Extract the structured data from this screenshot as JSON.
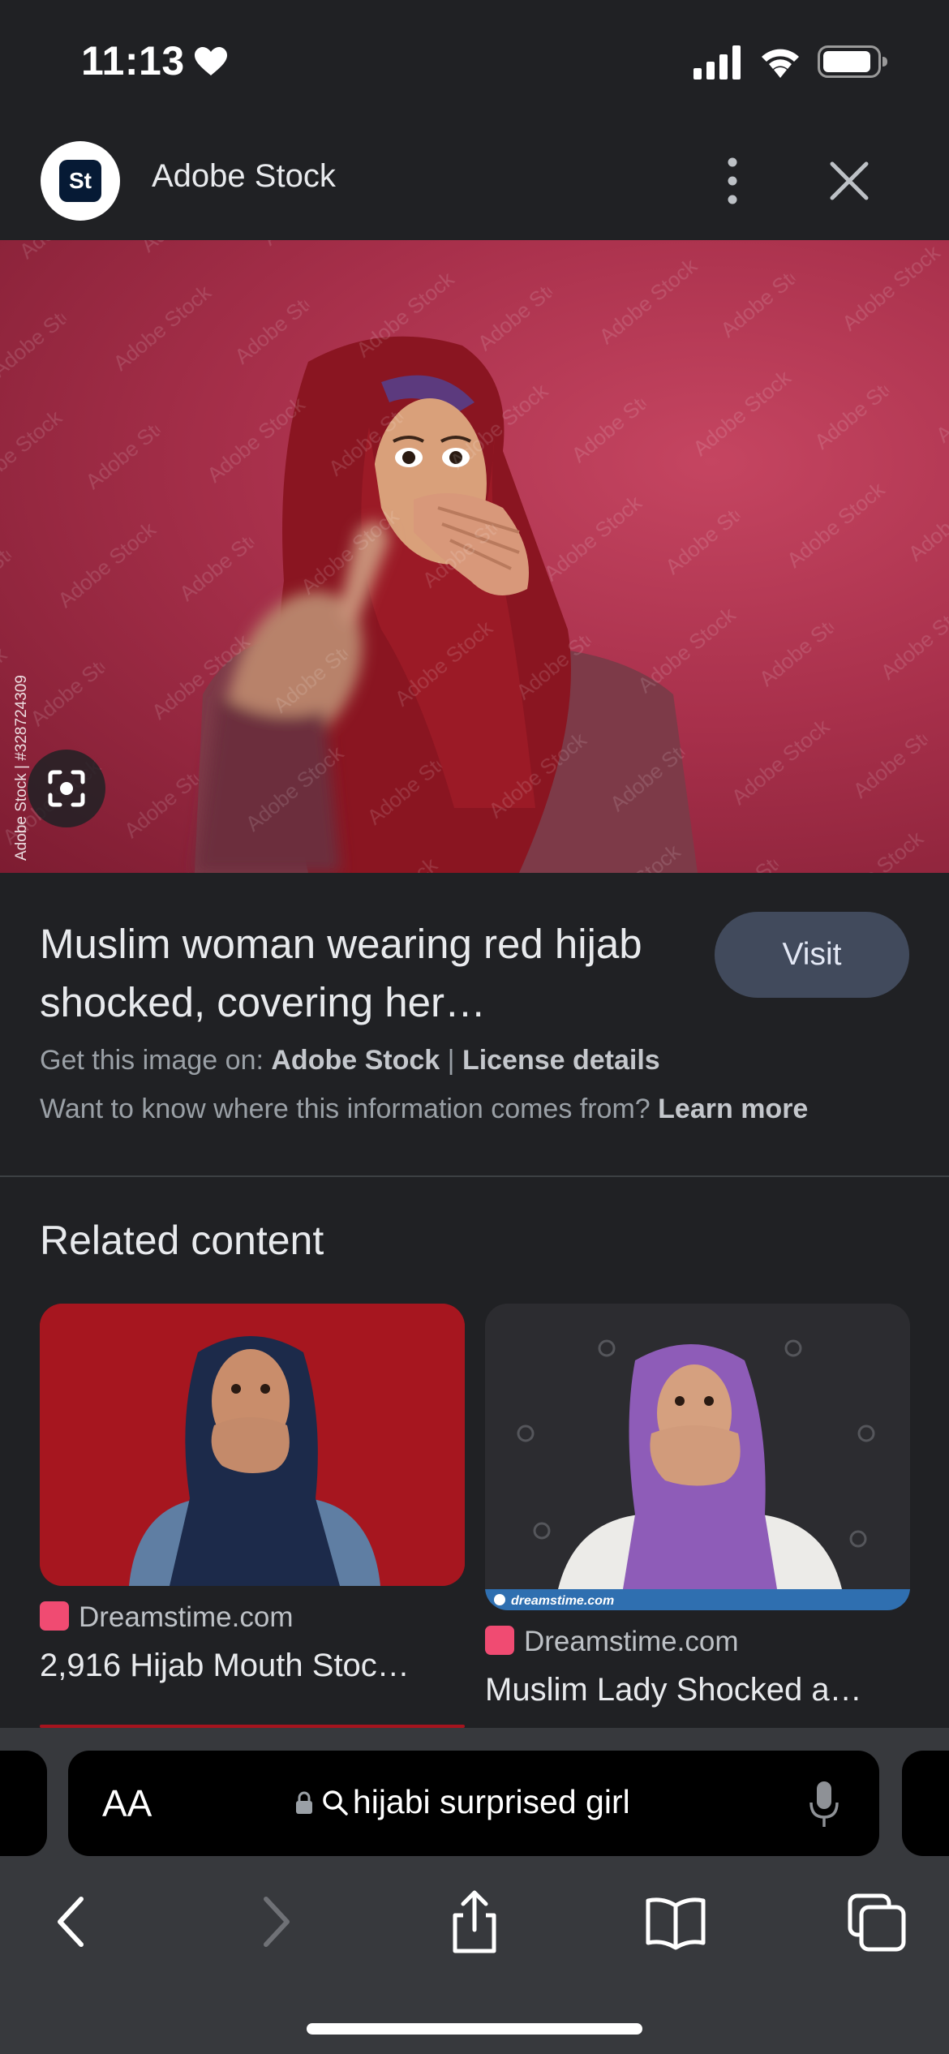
{
  "status_bar": {
    "time": "11:13",
    "icons": [
      "heart-icon",
      "signal-icon",
      "wifi-icon",
      "battery-icon"
    ]
  },
  "header": {
    "logo_text": "St",
    "title": "Adobe Stock",
    "icons": [
      "more-vert-icon",
      "close-icon"
    ]
  },
  "hero": {
    "credit": "Adobe Stock | #328724309",
    "watermark": "Adobe Stock",
    "lens_icon": "lens-search-icon"
  },
  "result": {
    "title": "Muslim woman wearing red hijab shocked, covering her…",
    "visit_label": "Visit",
    "source_prefix": "Get this image on:",
    "source_name": "Adobe Stock",
    "separator": "|",
    "license_label": "License details",
    "info_text": "Want to know where this information comes from?",
    "learn_more_label": "Learn more"
  },
  "related": {
    "heading": "Related content",
    "items": [
      {
        "source": "Dreamstime.com",
        "title": "2,916 Hijab Mouth Stoc…"
      },
      {
        "source": "Dreamstime.com",
        "title": "Muslim Lady Shocked a…",
        "image_caption": "dreamstime.com"
      }
    ]
  },
  "browser_bar": {
    "text_size_label": "AA",
    "url_text": "hijabi surprised girl",
    "icons": [
      "lock-icon",
      "search-icon",
      "mic-icon",
      "back-icon",
      "forward-icon",
      "share-icon",
      "bookmarks-icon",
      "tabs-icon"
    ]
  },
  "colors": {
    "background": "#202124",
    "hero_red": "#b53650",
    "visit_button": "#414a5c",
    "toolbar": "#37393d",
    "favicon": "#f04b72"
  }
}
